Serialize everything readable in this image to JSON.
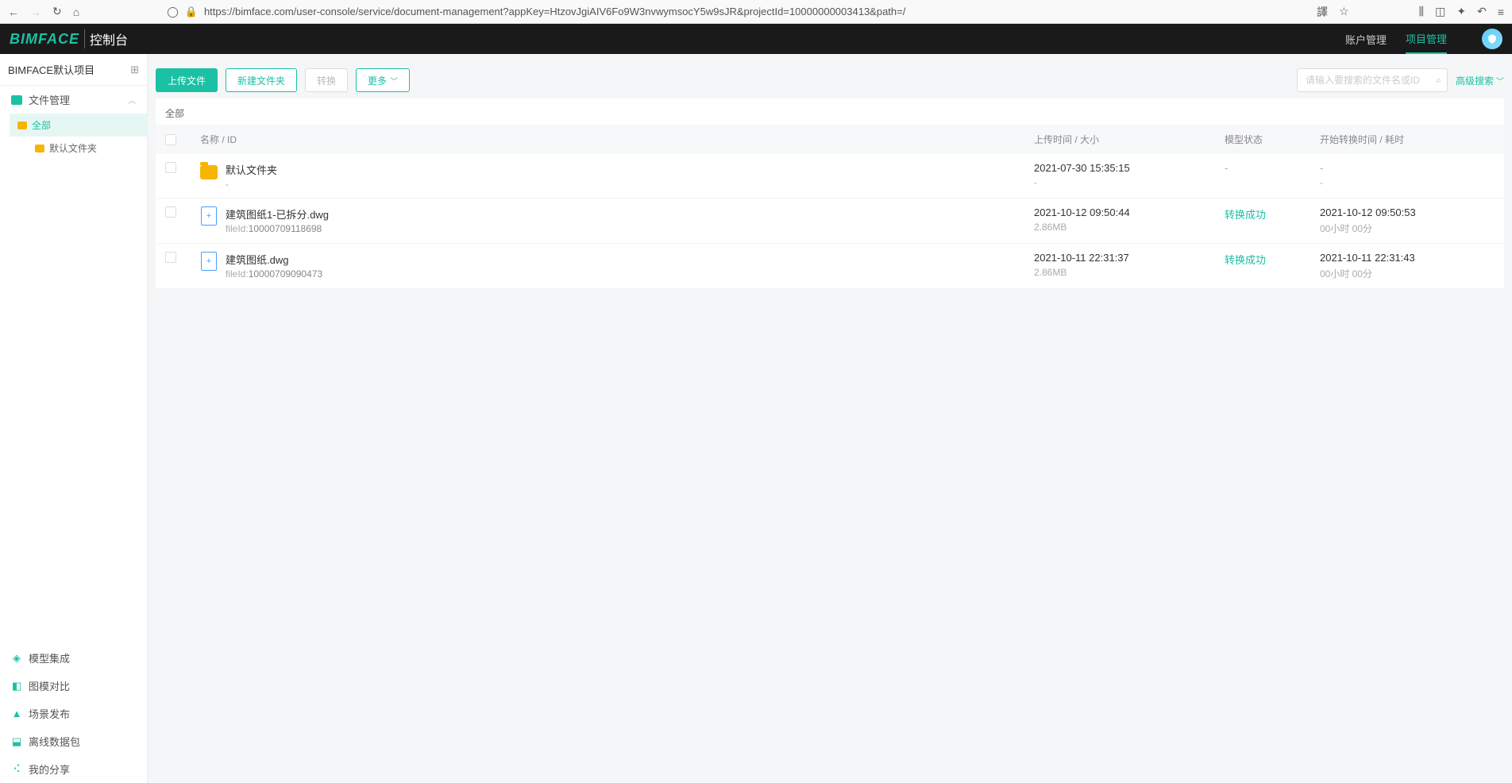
{
  "browser": {
    "url": "https://bimface.com/user-console/service/document-management?appKey=HtzovJgiAIV6Fo9W3nvwymsocY5w9sJR&projectId=10000000003413&path=/"
  },
  "header": {
    "logo_main": "BIMFACE",
    "logo_sub": "控制台",
    "menu": {
      "account": "账户管理",
      "project": "项目管理"
    }
  },
  "sidebar": {
    "project_name": "BIMFACE默认项目",
    "file_mgmt": "文件管理",
    "tree": {
      "all": "全部",
      "default_folder": "默认文件夹"
    },
    "items": {
      "model_integrate": "模型集成",
      "compare": "图模对比",
      "scene": "场景发布",
      "offline": "离线数据包",
      "share": "我的分享"
    }
  },
  "toolbar": {
    "upload": "上传文件",
    "new_folder": "新建文件夹",
    "convert": "转换",
    "more": "更多",
    "search_placeholder": "请输入要搜索的文件名或ID",
    "adv_search": "高级搜索"
  },
  "breadcrumb": "全部",
  "table": {
    "headers": {
      "name": "名称 / ID",
      "upload": "上传时间 / 大小",
      "status": "模型状态",
      "start": "开始转换时间 / 耗时"
    },
    "rows": [
      {
        "type": "folder",
        "name": "默认文件夹",
        "fileId_label": "-",
        "upload_time": "2021-07-30 15:35:15",
        "size": "-",
        "status": "-",
        "start_time": "-",
        "duration": "-"
      },
      {
        "type": "file",
        "name": "建筑图纸1-已拆分.dwg",
        "fileId_label": "fileId:",
        "fileId": "10000709118698",
        "upload_time": "2021-10-12 09:50:44",
        "size": "2.86MB",
        "status": "转换成功",
        "start_time": "2021-10-12 09:50:53",
        "duration": "00小时 00分"
      },
      {
        "type": "file",
        "name": "建筑图纸.dwg",
        "fileId_label": "fileId:",
        "fileId": "10000709090473",
        "upload_time": "2021-10-11 22:31:37",
        "size": "2.86MB",
        "status": "转换成功",
        "start_time": "2021-10-11 22:31:43",
        "duration": "00小时 00分"
      }
    ]
  }
}
